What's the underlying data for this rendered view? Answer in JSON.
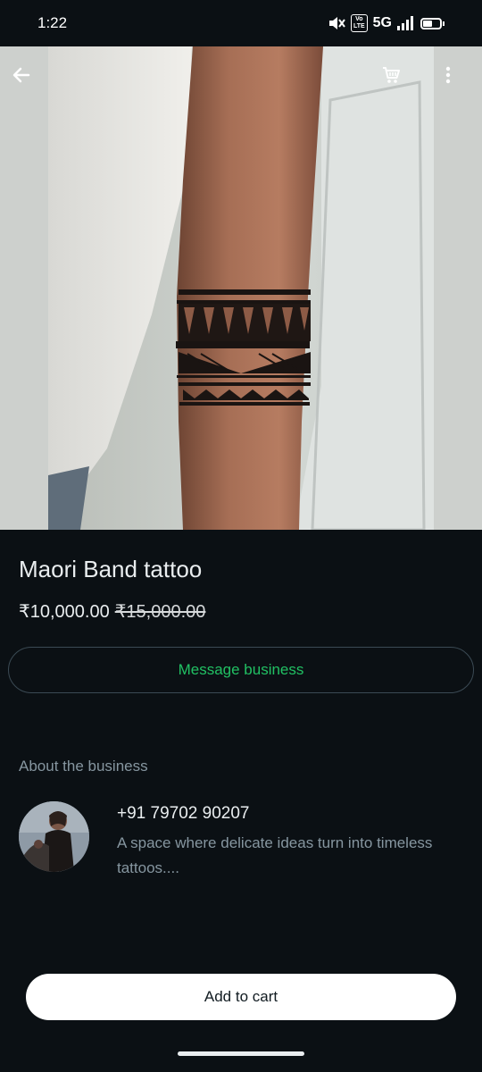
{
  "status_bar": {
    "time": "1:22",
    "network": "5G",
    "volte": "Vo\nLTE"
  },
  "topbar": {
    "back_icon": "arrow-left-icon",
    "cart_icon": "cart-icon",
    "menu_icon": "more-vert-icon"
  },
  "product": {
    "title": "Maori Band tattoo",
    "price": "₹10,000.00",
    "original_price": "₹15,000.00"
  },
  "actions": {
    "message_label": "Message business",
    "add_to_cart_label": "Add to cart"
  },
  "business": {
    "section_label": "About the business",
    "phone": "+91 79702 90207",
    "description": "A space where delicate ideas turn into timeless tattoos...."
  },
  "colors": {
    "accent": "#21c063",
    "background": "#0b1014",
    "muted": "#8696a0"
  }
}
